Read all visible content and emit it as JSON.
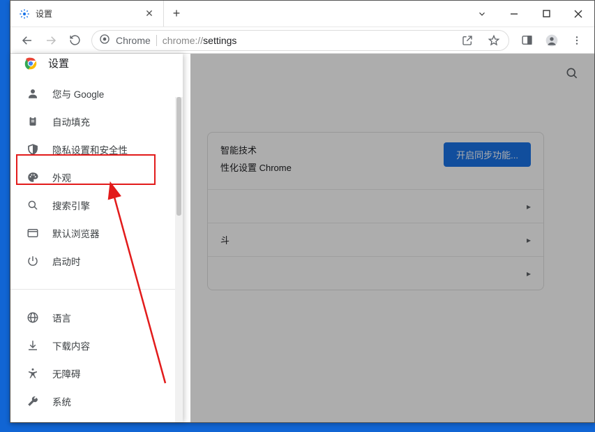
{
  "window": {
    "tab_title": "设置",
    "url_prefix": "Chrome",
    "url_path_prefix": "chrome://",
    "url_path": "settings"
  },
  "sidebar": {
    "title": "设置",
    "items_top": [
      {
        "label": "您与 Google",
        "icon": "person-icon"
      },
      {
        "label": "自动填充",
        "icon": "clipboard-icon"
      },
      {
        "label": "隐私设置和安全性",
        "icon": "shield-icon"
      },
      {
        "label": "外观",
        "icon": "palette-icon"
      },
      {
        "label": "搜索引擎",
        "icon": "search-icon"
      },
      {
        "label": "默认浏览器",
        "icon": "browser-icon"
      },
      {
        "label": "启动时",
        "icon": "power-icon"
      }
    ],
    "items_bottom": [
      {
        "label": "语言",
        "icon": "globe-icon"
      },
      {
        "label": "下载内容",
        "icon": "download-icon"
      },
      {
        "label": "无障碍",
        "icon": "accessibility-icon"
      },
      {
        "label": "系统",
        "icon": "wrench-icon"
      }
    ]
  },
  "card": {
    "line1_suffix": "智能技术",
    "line2_suffix": "性化设置 Chrome",
    "sync_button": "开启同步功能...",
    "row2_suffix": "斗"
  }
}
